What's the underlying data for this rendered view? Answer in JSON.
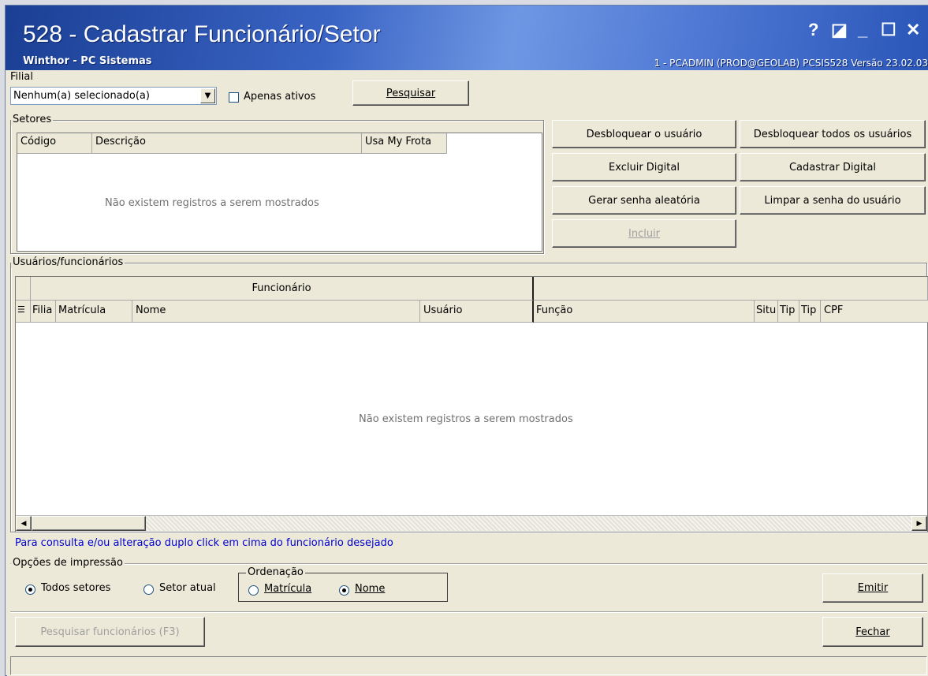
{
  "window": {
    "title": "528 - Cadastrar Funcionário/Setor",
    "subtitle": "Winthor - PC Sistemas",
    "info": "1 - PCADMIN (PROD@GEOLAB)  PCSIS528  Versão 23.02.03",
    "controls": {
      "help": "?",
      "restore_small": "◪",
      "minimize": "_",
      "maximize": "☐",
      "close": "✕"
    }
  },
  "filial": {
    "label": "Filial",
    "selected": "Nenhum(a) selecionado(a)",
    "apenas_ativos_label": "Apenas ativos",
    "apenas_ativos_checked": false,
    "search_button": "Pesquisar"
  },
  "setores": {
    "label": "Setores",
    "columns": [
      "Código",
      "Descrição",
      "Usa My Frota"
    ],
    "empty_text": "Não existem registros a serem mostrados"
  },
  "actions": {
    "desbloquear_usuario": "Desbloquear o usuário",
    "desbloquear_todos": "Desbloquear todos os usuários",
    "excluir_digital": "Excluir Digital",
    "cadastrar_digital": "Cadastrar Digital",
    "gerar_senha": "Gerar senha aleatória",
    "limpar_senha": "Limpar a senha do usuário",
    "incluir": "Incluir"
  },
  "usuarios": {
    "label": "Usuários/funcionários",
    "band_header": "Funcionário",
    "columns": [
      "Filia",
      "Matrícula",
      "Nome",
      "Usuário",
      "Função",
      "Situ",
      "Tip",
      "Tip",
      "CPF"
    ],
    "empty_text": "Não existem registros a serem mostrados"
  },
  "hint": "Para consulta e/ou alteração duplo click em cima do funcionário desejado",
  "impressao": {
    "label": "Opções de impressão",
    "todos_setores": "Todos setores",
    "setor_atual": "Setor atual",
    "selected": "todos_setores",
    "ordenacao_label": "Ordenação",
    "matricula": "Matrícula",
    "nome": "Nome",
    "ordenacao_selected": "nome",
    "emitir": "Emitir"
  },
  "footer": {
    "pesquisar_funcionarios": "Pesquisar funcionários (F3)",
    "fechar": "Fechar"
  },
  "colors": {
    "title_gradient_start": "#1a3f94",
    "title_gradient_mid": "#6e97e3",
    "hint_text": "#0000cc",
    "face": "#ece9d8"
  }
}
